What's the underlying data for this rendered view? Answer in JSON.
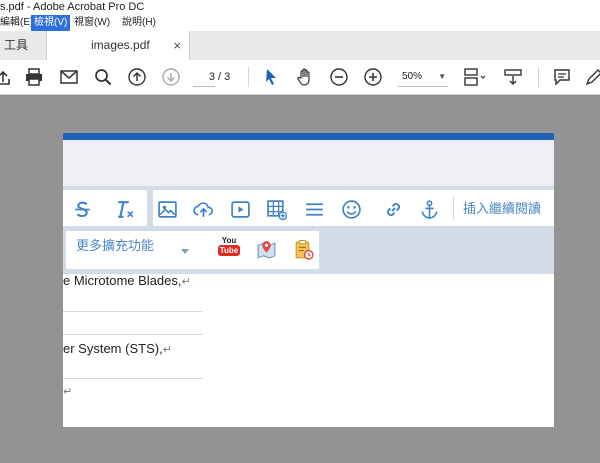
{
  "window": {
    "title": "s.pdf - Adobe Acrobat Pro DC"
  },
  "menu": {
    "items": [
      {
        "label": "編輯(E)",
        "active": false
      },
      {
        "label": "檢視(V)",
        "active": true
      },
      {
        "label": "視窗(W)",
        "active": false
      },
      {
        "label": "說明(H)",
        "active": false
      }
    ]
  },
  "tabs": {
    "tools_label": "工具",
    "document_label": "images.pdf",
    "close_glyph": "×"
  },
  "toolbar": {
    "current_page": "3",
    "total_pages": "/ 3",
    "zoom": "50%",
    "icons": [
      "share-icon",
      "print-icon",
      "email-icon",
      "search-icon",
      "page-up-icon",
      "page-down-icon",
      "select-cursor-icon",
      "hand-icon",
      "zoom-out-icon",
      "zoom-in-icon",
      "page-layout-icon",
      "scrolling-mode-icon",
      "comment-icon",
      "pen-icon"
    ]
  },
  "page_content": {
    "toolbar_icons": [
      "strikethrough-icon",
      "clear-format-icon",
      "image-icon",
      "upload-icon",
      "video-icon",
      "table-icon",
      "horizontal-rule-icon",
      "emoji-icon",
      "link-icon",
      "anchor-icon"
    ],
    "insert_continue_label": "插入繼續閱讀",
    "extensions_label": "更多擴充功能",
    "youtube_label_top": "You",
    "youtube_label_bottom": "Tube",
    "lines": [
      {
        "text": "e Microtome Blades,",
        "mark": "↵"
      },
      {
        "text": "er System (STS),",
        "mark": "↵"
      },
      {
        "text": "",
        "mark": "↵"
      }
    ]
  },
  "colors": {
    "accent": "#1e63b8",
    "link_blue": "#4c87c4",
    "menu_active": "#2e6fd9"
  }
}
